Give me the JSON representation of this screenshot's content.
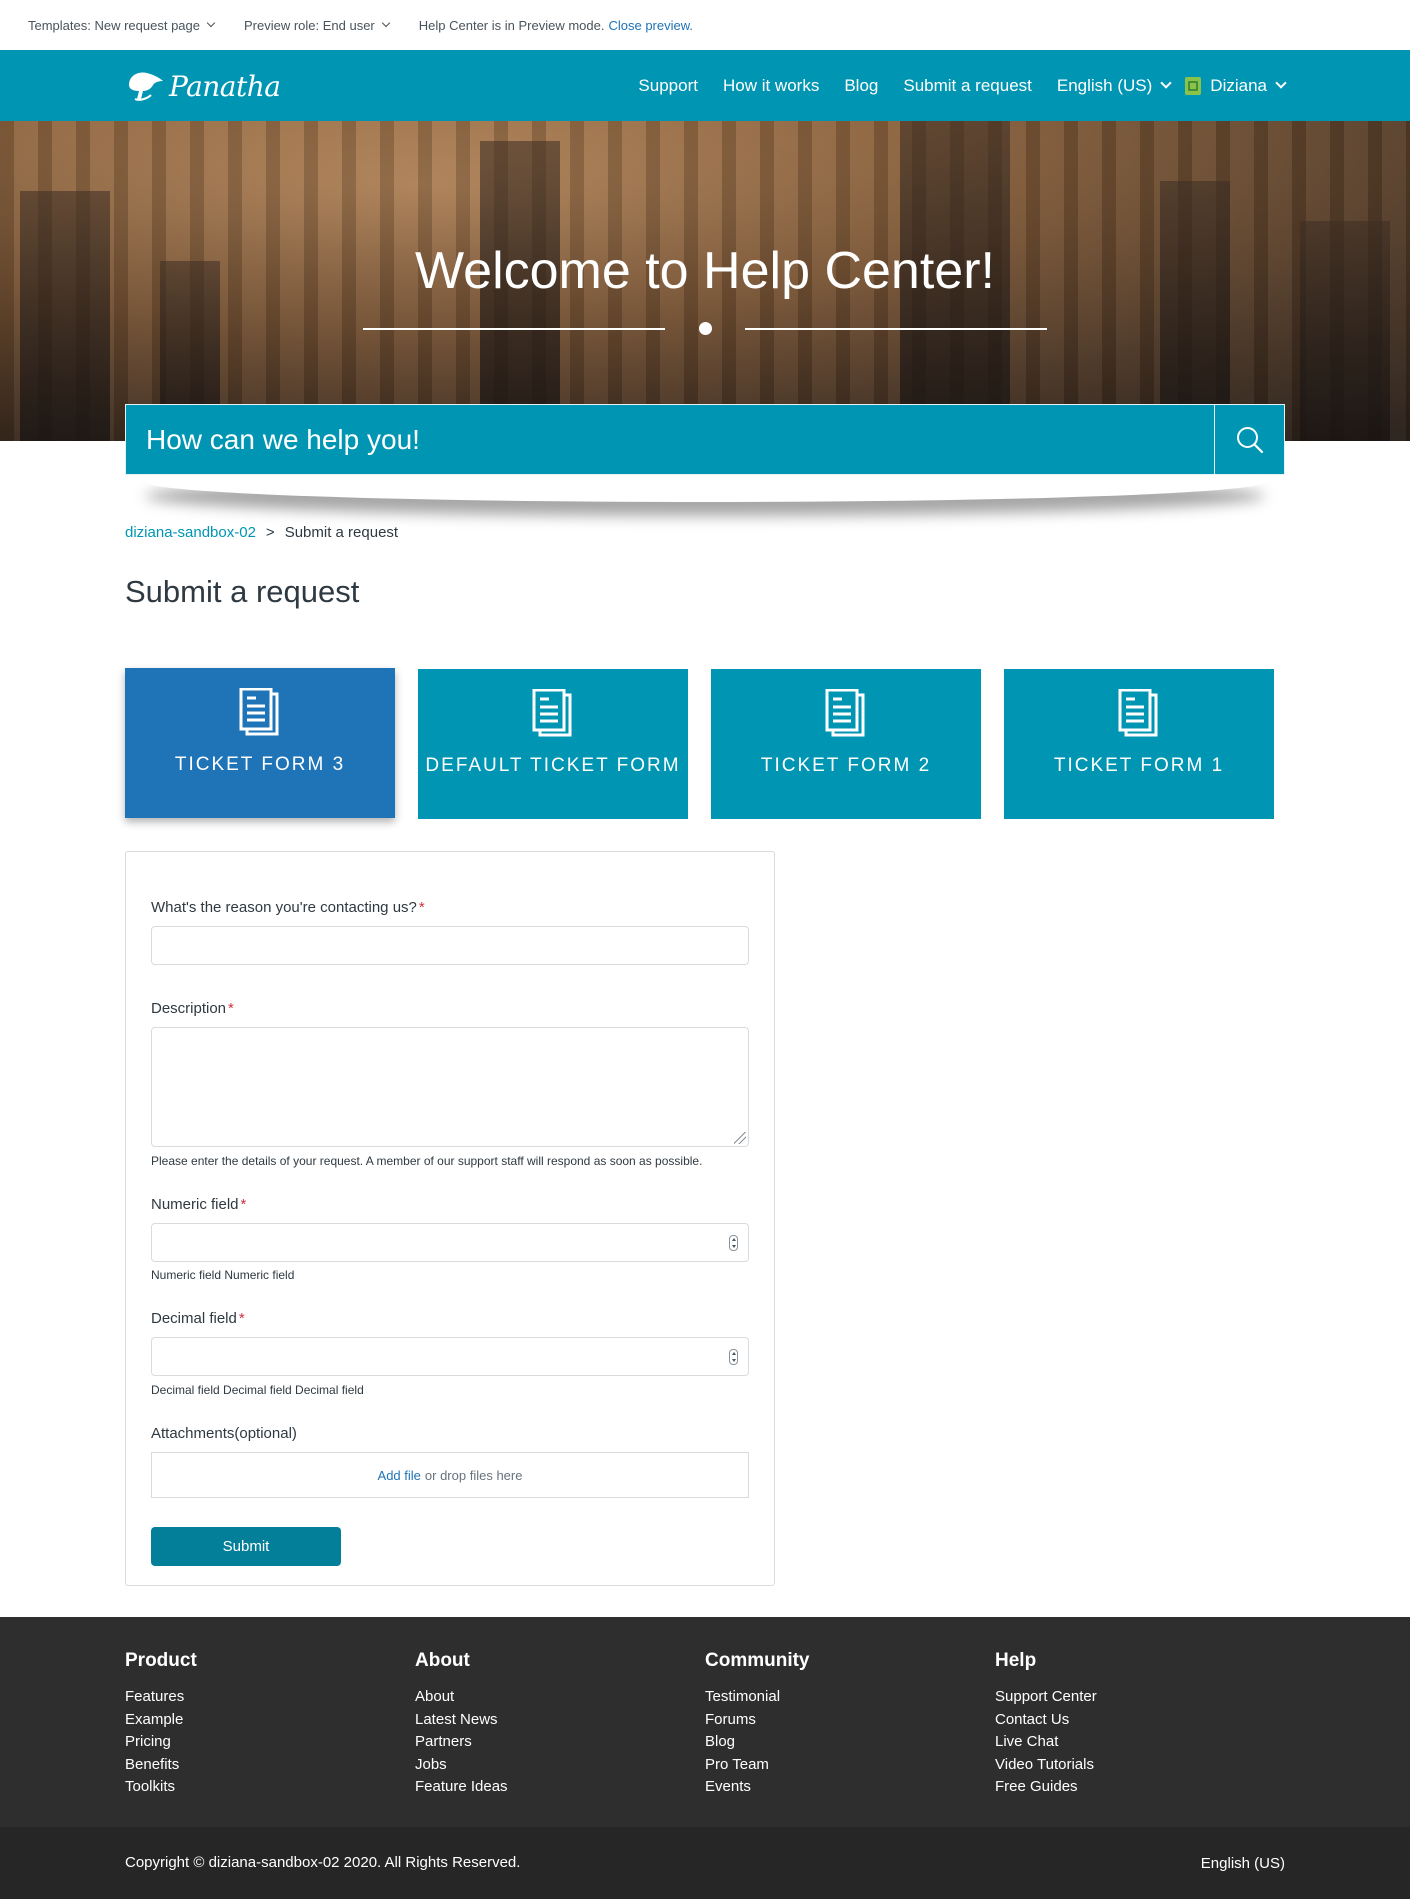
{
  "preview": {
    "template": "Templates: New request page",
    "role": "Preview role: End user",
    "mode_text": "Help Center is in Preview mode.",
    "close_link": "Close preview."
  },
  "header": {
    "logo_text": "Panatha",
    "nav": [
      "Support",
      "How it works",
      "Blog",
      "Submit a request"
    ],
    "language": "English (US)",
    "user": "Diziana"
  },
  "hero": {
    "title": "Welcome to Help Center!"
  },
  "search": {
    "placeholder": "How can we help you!"
  },
  "breadcrumb": {
    "home": "diziana-sandbox-02",
    "separator": ">",
    "current": "Submit a request"
  },
  "page": {
    "title": "Submit a request"
  },
  "forms": [
    {
      "label": "TICKET FORM 3",
      "active": true
    },
    {
      "label": "DEFAULT TICKET FORM",
      "active": false
    },
    {
      "label": "TICKET FORM 2",
      "active": false
    },
    {
      "label": "TICKET FORM 1",
      "active": false
    }
  ],
  "request_form": {
    "reason_label": "What's the reason you're contacting us?",
    "description_label": "Description",
    "description_hint": "Please enter the details of your request. A member of our support staff will respond as soon as possible.",
    "numeric_label": "Numeric field",
    "numeric_hint": "Numeric field Numeric field",
    "decimal_label": "Decimal field",
    "decimal_hint": "Decimal field Decimal field Decimal field",
    "attachments_label": "Attachments(optional)",
    "add_file": "Add file",
    "drop_text": "or drop files here",
    "required_mark": "*",
    "submit": "Submit"
  },
  "footer": {
    "columns": [
      {
        "title": "Product",
        "links": [
          "Features",
          "Example",
          "Pricing",
          "Benefits",
          "Toolkits"
        ]
      },
      {
        "title": "About",
        "links": [
          "About",
          "Latest News",
          "Partners",
          "Jobs",
          "Feature Ideas"
        ]
      },
      {
        "title": "Community",
        "links": [
          "Testimonial",
          "Forums",
          "Blog",
          "Pro Team",
          "Events"
        ]
      },
      {
        "title": "Help",
        "links": [
          "Support Center",
          "Contact Us",
          "Live Chat",
          "Video Tutorials",
          "Free Guides"
        ]
      }
    ],
    "copyright": "Copyright © diziana-sandbox-02 2020. All Rights Reserved.",
    "language": "English (US)"
  },
  "colors": {
    "brand": "#0096b3",
    "active_tile": "#1f73b7",
    "submit": "#037f9a",
    "footer": "#2e2e2e"
  }
}
